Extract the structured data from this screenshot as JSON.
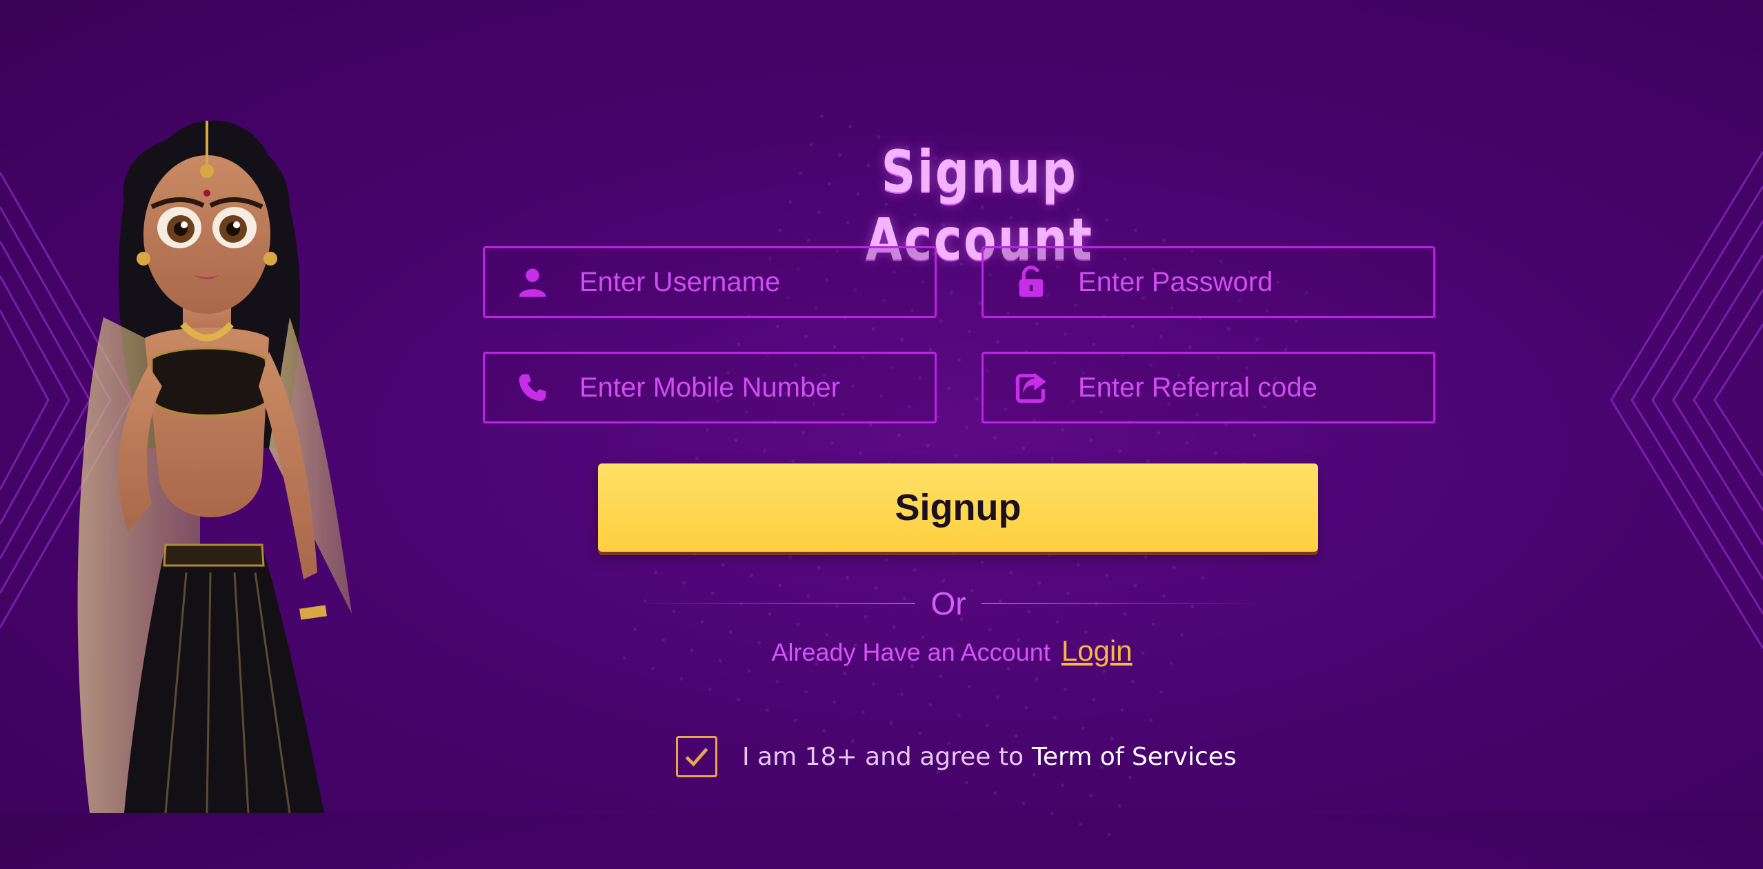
{
  "title": "Signup Account",
  "form": {
    "username_placeholder": "Enter Username",
    "password_placeholder": "Enter Password",
    "mobile_placeholder": "Enter Mobile Number",
    "referral_placeholder": "Enter Referral code"
  },
  "signup_label": "Signup",
  "or_label": "Or",
  "login_prompt": "Already Have an Account",
  "login_label": "Login",
  "agree_text": "I am 18+ and agree to",
  "terms_label": "Term of Services",
  "agree_checked": true,
  "icons": {
    "username": "user-icon",
    "password": "unlock-icon",
    "mobile": "phone-icon",
    "referral": "share-icon",
    "checkbox": "checkmark-icon"
  },
  "colors": {
    "accent": "#c020e8",
    "placeholder": "#d04df2",
    "button": "#ffd44f",
    "link": "#f8b83e",
    "background": "#4a0470"
  }
}
